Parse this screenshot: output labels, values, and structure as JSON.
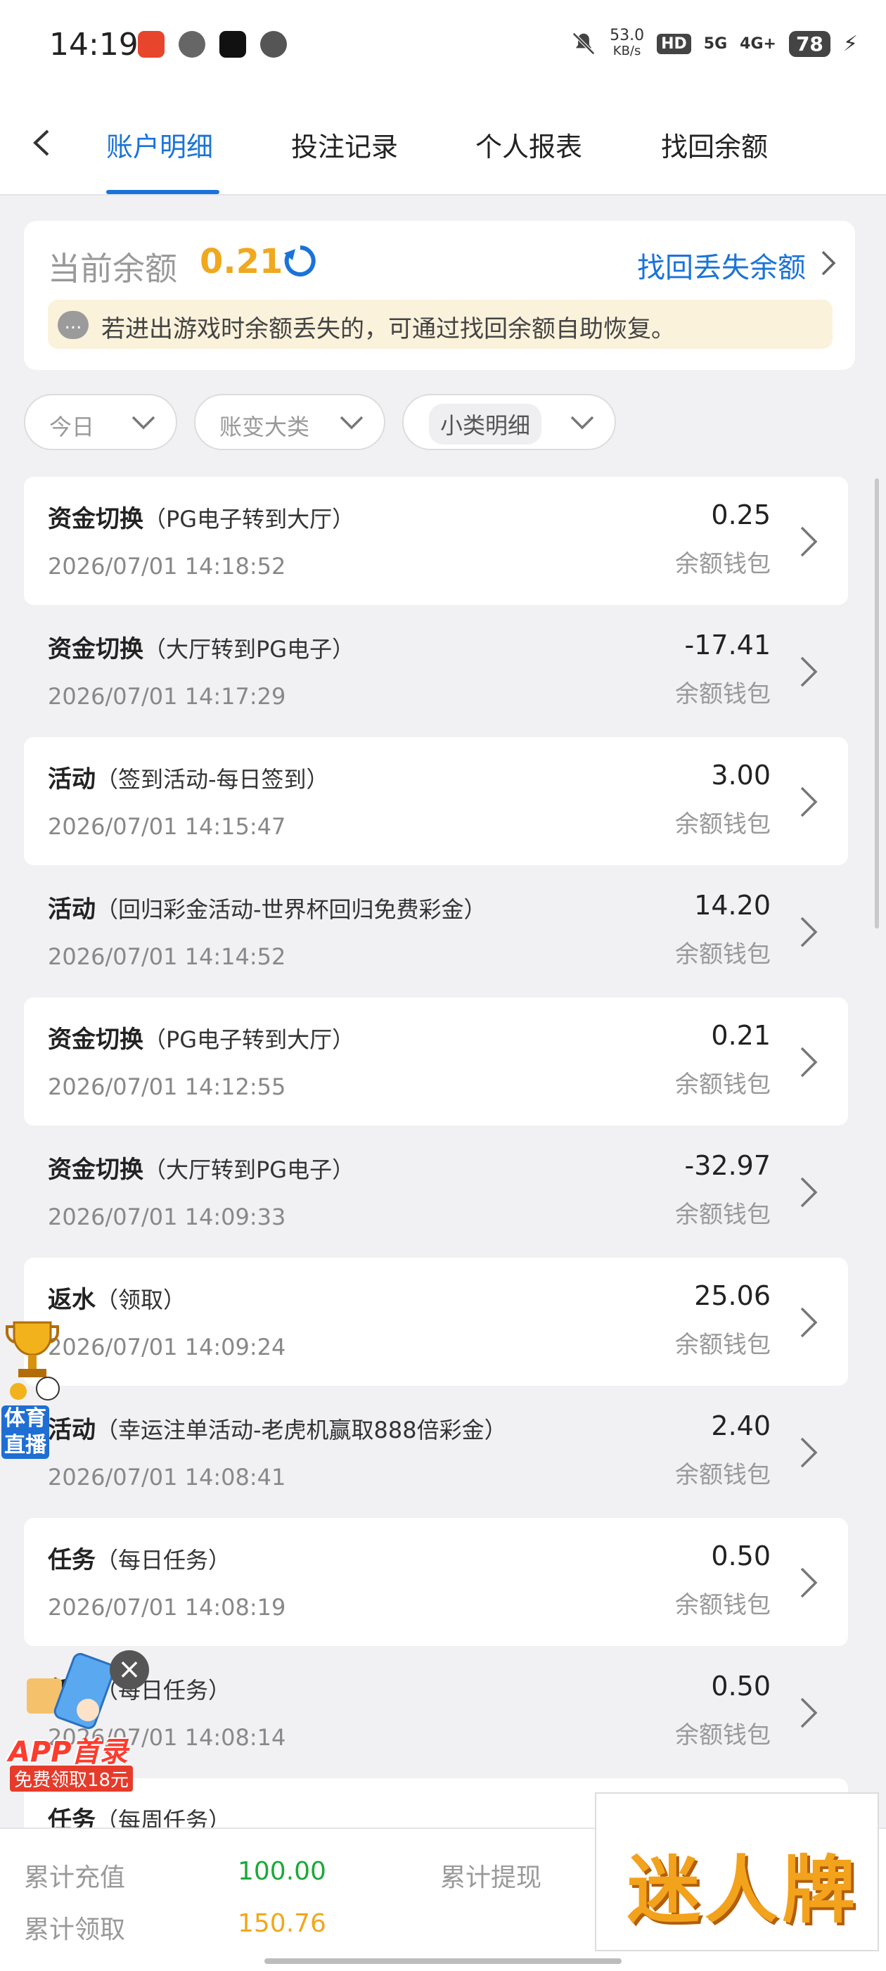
{
  "status_bar": {
    "time": "14:19",
    "speed_value": "53.0",
    "speed_unit": "KB/s",
    "hd": "HD",
    "sim_a": "5G",
    "sim_b": "4G+",
    "battery": "78"
  },
  "nav": {
    "tabs": [
      "账户明细",
      "投注记录",
      "个人报表",
      "找回余额"
    ]
  },
  "balance": {
    "label": "当前余额",
    "value": "0.21",
    "recover_label": "找回丢失余额",
    "notice_icon": "...",
    "notice": "若进出游戏时余额丢失的，可通过找回余额自助恢复。"
  },
  "filters": {
    "day": "今日",
    "category": "账变大类",
    "detail": "小类明细"
  },
  "items": [
    {
      "title": "资金切换",
      "sub": "（PG电子转到大厅）",
      "time": "2026/07/01 14:18:52",
      "amount": "0.25",
      "wallet": "余额钱包"
    },
    {
      "title": "资金切换",
      "sub": "（大厅转到PG电子）",
      "time": "2026/07/01 14:17:29",
      "amount": "-17.41",
      "wallet": "余额钱包"
    },
    {
      "title": "活动",
      "sub": "（签到活动-每日签到）",
      "time": "2026/07/01 14:15:47",
      "amount": "3.00",
      "wallet": "余额钱包"
    },
    {
      "title": "活动",
      "sub": "（回归彩金活动-世界杯回归免费彩金）",
      "time": "2026/07/01 14:14:52",
      "amount": "14.20",
      "wallet": "余额钱包"
    },
    {
      "title": "资金切换",
      "sub": "（PG电子转到大厅）",
      "time": "2026/07/01 14:12:55",
      "amount": "0.21",
      "wallet": "余额钱包"
    },
    {
      "title": "资金切换",
      "sub": "（大厅转到PG电子）",
      "time": "2026/07/01 14:09:33",
      "amount": "-32.97",
      "wallet": "余额钱包"
    },
    {
      "title": "返水",
      "sub": "（领取）",
      "time": "2026/07/01 14:09:24",
      "amount": "25.06",
      "wallet": "余额钱包"
    },
    {
      "title": "活动",
      "sub": "（幸运注单活动-老虎机赢取888倍彩金）",
      "time": "2026/07/01 14:08:41",
      "amount": "2.40",
      "wallet": "余额钱包"
    },
    {
      "title": "任务",
      "sub": "（每日任务）",
      "time": "2026/07/01 14:08:19",
      "amount": "0.50",
      "wallet": "余额钱包"
    },
    {
      "title": "任务",
      "sub": "（每日任务）",
      "time": "2026/07/01 14:08:14",
      "amount": "0.50",
      "wallet": "余额钱包"
    },
    {
      "title": "任务",
      "sub": "（每周任务）",
      "time": "",
      "amount": "",
      "wallet": ""
    }
  ],
  "footer": {
    "deposit_label": "累计充值",
    "deposit_value": "100.00",
    "withdraw_label": "累计提现",
    "claim_label": "累计领取",
    "claim_value": "150.76"
  },
  "logo_text": "迷人牌",
  "ads": {
    "sports_line1": "体育",
    "sports_line2": "直播",
    "close": "×",
    "app_title": "APP首录",
    "app_sub": "免费领取18元"
  },
  "colors": {
    "accent": "#1a73d9",
    "balance": "#f0a81e",
    "green": "#1fa83a"
  }
}
